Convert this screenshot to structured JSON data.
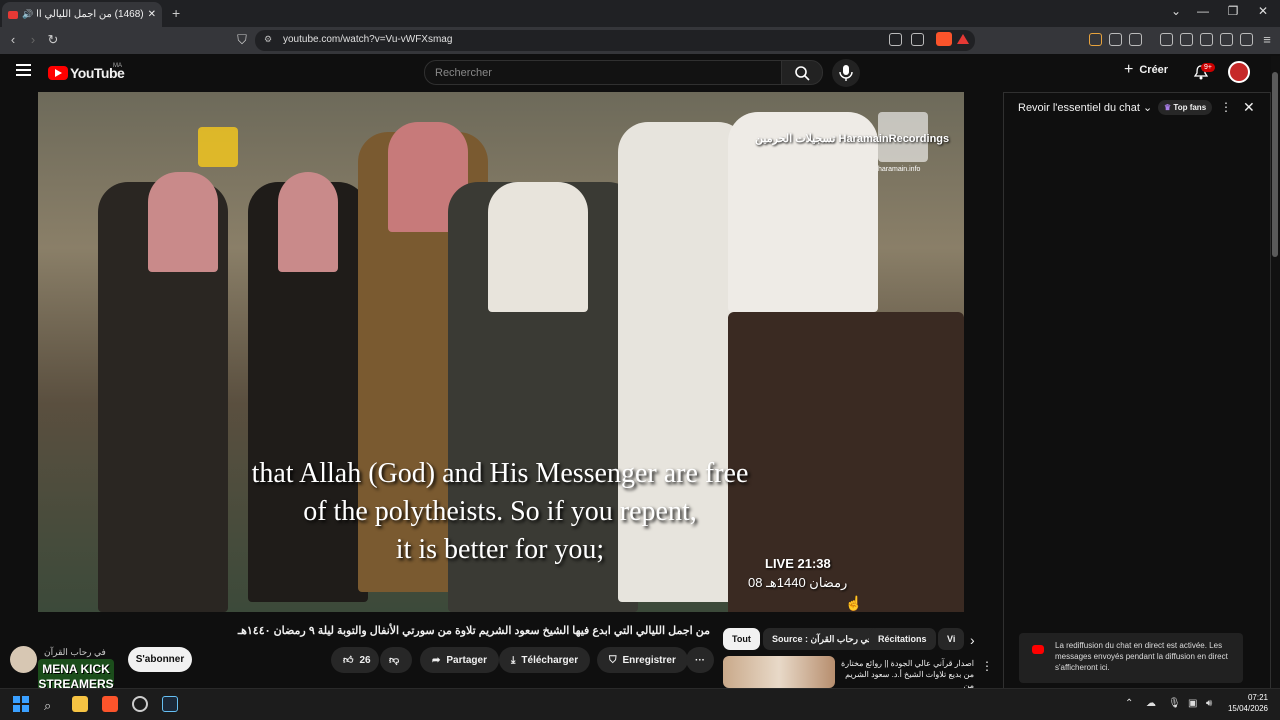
{
  "browser": {
    "tab_title": "(1468) من اجمل الليالي التي ا...",
    "new_tab": "+",
    "url": "youtube.com/watch?v=Vu-vWFXsmag",
    "window_controls": [
      "⌄",
      "—",
      "❐",
      "✕"
    ]
  },
  "header": {
    "logo_text": "YouTube",
    "country_code": "MA",
    "search_placeholder": "Rechercher",
    "create_label": "Créer",
    "notifications_badge": "9+"
  },
  "video": {
    "subtitle_line1": "that Allah (God) and His Messenger are free",
    "subtitle_line2": "of the polytheists. So if you repent,",
    "subtitle_line3": "it is better for you;",
    "live_timestamp": "LIVE 21:38",
    "live_date": "08 رمضان 1440هـ",
    "watermark": "تسجيلات الحرمين HaramainRecordings",
    "watermark_site": "haramain.info"
  },
  "details": {
    "title": "من اجمل الليالي التي ابدع فيها الشيخ سعود الشريم تلاوة من سورتي الأنفال والتوبة ليلة ٩ رمضان ١٤٤٠هـ",
    "channel_name": "في رحاب القرآن",
    "subscribe_label": "S'abonner",
    "like_count": "26",
    "share_label": "Partager",
    "download_label": "Télécharger",
    "save_label": "Enregistrer",
    "more_label": "···",
    "overlay_text": "MENA KICK STREAMERS"
  },
  "chips": {
    "all": "Tout",
    "source": "Source : في رحاب القرآن",
    "recitations": "Récitations",
    "partial": "Vi"
  },
  "related": {
    "title": "اصدار قرآني عالي الجودة || روائع مختارة من بديع تلاوات الشيخ أ.د. سعود الشريم من"
  },
  "chat": {
    "title": "Revoir l'essentiel du chat",
    "top_fans": "Top fans",
    "notice": "La rediffusion du chat en direct est activée. Les messages envoyés pendant la diffusion en direct s'afficheront ici."
  },
  "taskbar": {
    "time": "07:21",
    "date": "15/04/2026"
  },
  "colors": {
    "youtube_red": "#ff0000",
    "background": "#0f0f0f",
    "pill": "#272727"
  }
}
